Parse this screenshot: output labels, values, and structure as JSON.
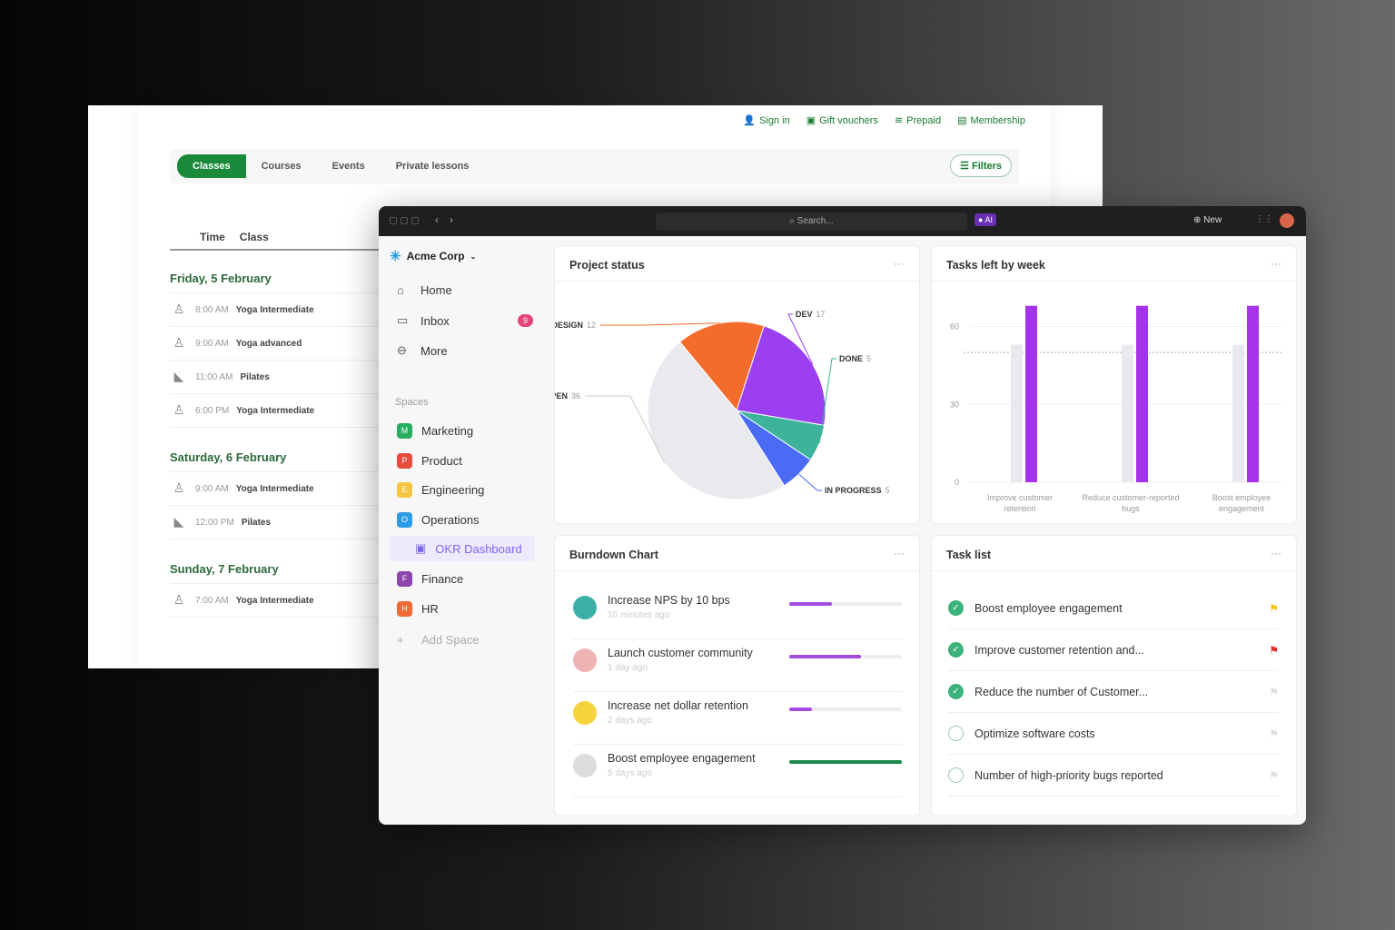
{
  "booking": {
    "top_links": [
      {
        "icon": "user-icon",
        "label": "Sign in"
      },
      {
        "icon": "gift-icon",
        "label": "Gift vouchers"
      },
      {
        "icon": "layers-icon",
        "label": "Prepaid"
      },
      {
        "icon": "card-icon",
        "label": "Membership"
      }
    ],
    "tabs": [
      "Classes",
      "Courses",
      "Events",
      "Private lessons"
    ],
    "active_tab": "Classes",
    "filters_label": "Filters",
    "columns": [
      "Time",
      "Class"
    ],
    "days": [
      {
        "label": "Friday, 5 February",
        "classes": [
          {
            "time": "8:00 AM",
            "name": "Yoga Intermediate"
          },
          {
            "time": "9:00 AM",
            "name": "Yoga advanced"
          },
          {
            "time": "11:00 AM",
            "name": "Pilates"
          },
          {
            "time": "6:00 PM",
            "name": "Yoga Intermediate"
          }
        ]
      },
      {
        "label": "Saturday, 6 February",
        "classes": [
          {
            "time": "9:00 AM",
            "name": "Yoga Intermediate"
          },
          {
            "time": "12:00 PM",
            "name": "Pilates"
          }
        ]
      },
      {
        "label": "Sunday, 7 February",
        "classes": [
          {
            "time": "7:00 AM",
            "name": "Yoga Intermediate"
          }
        ]
      }
    ],
    "accent": "#1a8a3a"
  },
  "app": {
    "search_placeholder": "Search...",
    "ai_label": "AI",
    "new_label": "New",
    "workspace": "Acme Corp",
    "nav": [
      {
        "label": "Home",
        "icon": "home-icon"
      },
      {
        "label": "Inbox",
        "icon": "inbox-icon",
        "badge": "9"
      },
      {
        "label": "More",
        "icon": "more-icon"
      }
    ],
    "spaces_label": "Spaces",
    "spaces": [
      {
        "letter": "M",
        "label": "Marketing",
        "color": "#27ae60"
      },
      {
        "letter": "P",
        "label": "Product",
        "color": "#e74c3c"
      },
      {
        "letter": "E",
        "label": "Engineering",
        "color": "#f5c542"
      },
      {
        "letter": "O",
        "label": "Operations",
        "color": "#2e9be6"
      },
      {
        "letter": "",
        "label": "OKR Dashboard",
        "color": "#7b68ee",
        "active": true
      },
      {
        "letter": "F",
        "label": "Finance",
        "color": "#8e44ad"
      },
      {
        "letter": "H",
        "label": "HR",
        "color": "#f06a35"
      }
    ],
    "add_space": "Add Space"
  },
  "project_status": {
    "title": "Project status",
    "more": "···"
  },
  "tasks_by_week": {
    "title": "Tasks left by week",
    "more": "···"
  },
  "burndown": {
    "title": "Burndown Chart",
    "more": "···",
    "items": [
      {
        "name": "Increase NPS by 10 bps",
        "time": "10 minutes ago",
        "progress": 0.38,
        "color": "#a34de0",
        "avatar": "#3bb0a6"
      },
      {
        "name": "Launch customer community",
        "time": "1 day ago",
        "progress": 0.64,
        "color": "#a34de0",
        "avatar": "#f0b3b3"
      },
      {
        "name": "Increase net dollar retention",
        "time": "2 days ago",
        "progress": 0.2,
        "color": "#a34de0",
        "avatar": "#f5d33b"
      },
      {
        "name": "Boost employee engagement",
        "time": "5 days ago",
        "progress": 1.0,
        "color": "#1a8a4a",
        "avatar": "#ddd"
      }
    ]
  },
  "task_list": {
    "title": "Task list",
    "more": "···",
    "items": [
      {
        "name": "Boost employee engagement",
        "done": true,
        "flag": "#f5c518"
      },
      {
        "name": "Improve customer retention and...",
        "done": true,
        "flag": "#e0302b"
      },
      {
        "name": "Reduce the number of Customer...",
        "done": true,
        "flag": "#ddd"
      },
      {
        "name": "Optimize software costs",
        "done": false,
        "flag": "#ddd"
      },
      {
        "name": "Number of high-priority bugs reported",
        "done": false,
        "flag": "#ddd"
      }
    ]
  },
  "chart_data": [
    {
      "type": "pie",
      "slices": [
        {
          "label": "DESIGN",
          "value": 12,
          "color": "#f46c2b"
        },
        {
          "label": "DEV",
          "value": 17,
          "color": "#9b3ff0"
        },
        {
          "label": "DONE",
          "value": 5,
          "color": "#3cb39a"
        },
        {
          "label": "IN PROGRESS",
          "value": 5,
          "color": "#4a6cf5"
        },
        {
          "label": "OPEN",
          "value": 36,
          "color": "#e9eaee"
        }
      ]
    },
    {
      "type": "bar",
      "categories": [
        "Improve customer retention",
        "Reduce customer-reported bugs",
        "Boost employee engagement"
      ],
      "series": [
        {
          "values": [
            53,
            53,
            53
          ],
          "color": "#e8e9ec"
        },
        {
          "values": [
            68,
            68,
            68
          ],
          "color": "#a534e8"
        }
      ],
      "reference_line": 50,
      "yticks": [
        0,
        30,
        60
      ],
      "ylim": [
        0,
        70
      ],
      "grid": true
    }
  ]
}
